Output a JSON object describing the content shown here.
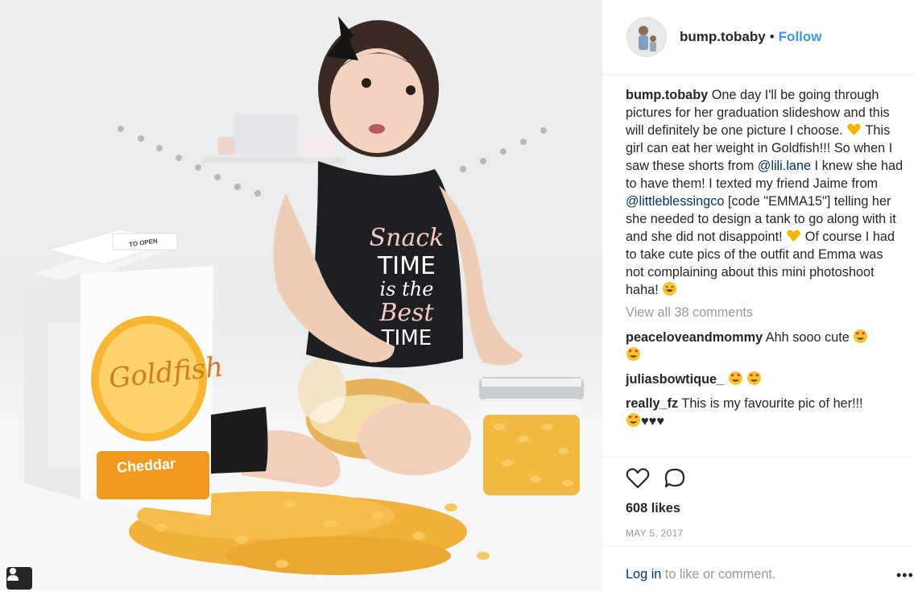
{
  "post": {
    "username": "bump.tobaby",
    "separator": "•",
    "follow_label": "Follow",
    "caption": {
      "username": "bump.tobaby",
      "part1": "One day I'll be going through pictures for her graduation slideshow and this will definitely be one picture I choose.",
      "part2": "This girl can eat her weight in Goldfish!!! So when I saw these shorts from",
      "mention1": "@lili.lane",
      "part3": "I knew she had to have them! I texted my friend Jaime from",
      "mention2": "@littleblessingco",
      "part4": "[code \"EMMA15\"] telling her she needed to design a tank to go along with it and she did not disappoint!",
      "part5": "Of course I had to take cute pics of the outfit and Emma was not complaining about this mini photoshoot haha!"
    },
    "view_all": "View all 38 comments",
    "comments": [
      {
        "user": "peaceloveandmommy",
        "text": "Ahh sooo cute"
      },
      {
        "user": "juliasbowtique_",
        "text": ""
      },
      {
        "user": "really_fz",
        "text": "This is my favourite pic of her!!!",
        "hearts": "♥♥♥"
      }
    ],
    "likes": "608 likes",
    "date": "MAY 5, 2017",
    "login_link": "Log in",
    "login_rest": "to like or comment.",
    "more": "•••"
  },
  "photo": {
    "carton_brand": "Goldfish",
    "carton_flavor": "Cheddar",
    "carton_open": "TO OPEN",
    "shirt_text": [
      "Snack",
      "TIME",
      "is the",
      "Best",
      "TIME"
    ]
  },
  "icons": [
    "heart-icon",
    "comment-icon",
    "tag-user-icon",
    "yellow-heart-emoji",
    "laughing-emoji",
    "heart-eyes-emoji"
  ],
  "colors": {
    "link": "#003569",
    "follow": "#3897f0",
    "muted": "#999999"
  }
}
